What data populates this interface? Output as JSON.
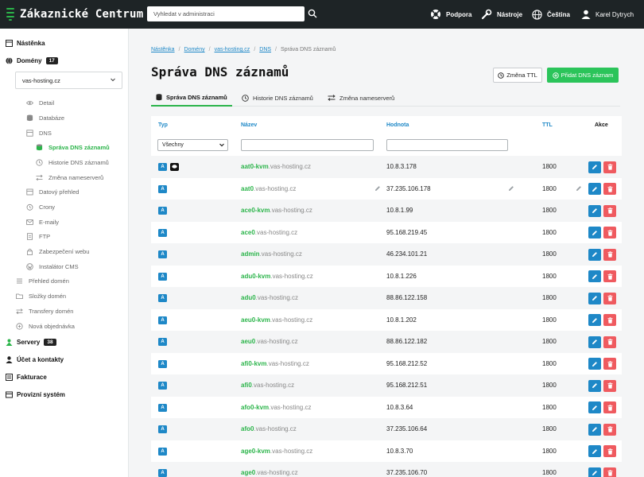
{
  "app": {
    "title": "Zákaznické Centrum"
  },
  "search": {
    "placeholder": "Vyhledat v administraci"
  },
  "top_nav": {
    "support": "Podpora",
    "tools": "Nástroje",
    "language": "Čeština",
    "user": "Karel Dytrych"
  },
  "sidebar": {
    "dashboard": "Nástěnka",
    "domains": "Domény",
    "domains_count": "17",
    "selected_domain": "vas-hosting.cz",
    "domain_items": [
      {
        "label": "Detail",
        "icon": "eye-icon"
      },
      {
        "label": "Databáze",
        "icon": "database-icon"
      },
      {
        "label": "DNS",
        "icon": "dns-icon"
      },
      {
        "label": "Správa DNS záznamů",
        "icon": "database-icon",
        "active": true
      },
      {
        "label": "Historie DNS záznamů",
        "icon": "history-icon"
      },
      {
        "label": "Změna nameserverů",
        "icon": "nameserver-icon"
      },
      {
        "label": "Datový přehled",
        "icon": "chart-icon"
      },
      {
        "label": "Crony",
        "icon": "clock-icon"
      },
      {
        "label": "E-maily",
        "icon": "mail-icon"
      },
      {
        "label": "FTP",
        "icon": "file-icon"
      },
      {
        "label": "Zabezpečení webu",
        "icon": "lock-icon"
      },
      {
        "label": "Instalátor CMS",
        "icon": "wordpress-icon"
      },
      {
        "label": "Přehled domén",
        "icon": "list-icon"
      },
      {
        "label": "Složky domén",
        "icon": "folder-icon"
      },
      {
        "label": "Transfery domén",
        "icon": "transfer-icon"
      },
      {
        "label": "Nová objednávka",
        "icon": "plus-circle-icon"
      }
    ],
    "servers": "Servery",
    "servers_count": "38",
    "account": "Účet a kontakty",
    "billing": "Fakturace",
    "system": "Provizní systém"
  },
  "breadcrumb": {
    "items": [
      "Nástěnka",
      "Domény",
      "vas-hosting.cz",
      "DNS"
    ],
    "current": "Správa DNS záznamů"
  },
  "page": {
    "title": "Správa DNS záznamů",
    "ttl_button": "Změna TTL",
    "add_button": "Přidat DNS záznam"
  },
  "tabs": [
    "Správa DNS záznamů",
    "Historie DNS záznamů",
    "Změna nameserverů"
  ],
  "table": {
    "headers": {
      "type": "Typ",
      "name": "Název",
      "value": "Hodnota",
      "ttl": "TTL",
      "actions": "Akce"
    },
    "type_filter": "Všechny",
    "domain_suffix": ".vas-hosting.cz",
    "rows": [
      {
        "type": "A",
        "host": "aat0-kvm",
        "value": "10.8.3.178",
        "ttl": "1800",
        "comment": true
      },
      {
        "type": "A",
        "host": "aat0",
        "value": "37.235.106.178",
        "ttl": "1800",
        "editing": true
      },
      {
        "type": "A",
        "host": "ace0-kvm",
        "value": "10.8.1.99",
        "ttl": "1800"
      },
      {
        "type": "A",
        "host": "ace0",
        "value": "95.168.219.45",
        "ttl": "1800"
      },
      {
        "type": "A",
        "host": "admin",
        "value": "46.234.101.21",
        "ttl": "1800"
      },
      {
        "type": "A",
        "host": "adu0-kvm",
        "value": "10.8.1.226",
        "ttl": "1800"
      },
      {
        "type": "A",
        "host": "adu0",
        "value": "88.86.122.158",
        "ttl": "1800"
      },
      {
        "type": "A",
        "host": "aeu0-kvm",
        "value": "10.8.1.202",
        "ttl": "1800"
      },
      {
        "type": "A",
        "host": "aeu0",
        "value": "88.86.122.182",
        "ttl": "1800"
      },
      {
        "type": "A",
        "host": "afi0-kvm",
        "value": "95.168.212.52",
        "ttl": "1800"
      },
      {
        "type": "A",
        "host": "afi0",
        "value": "95.168.212.51",
        "ttl": "1800"
      },
      {
        "type": "A",
        "host": "afo0-kvm",
        "value": "10.8.3.64",
        "ttl": "1800"
      },
      {
        "type": "A",
        "host": "afo0",
        "value": "37.235.106.64",
        "ttl": "1800"
      },
      {
        "type": "A",
        "host": "age0-kvm",
        "value": "10.8.3.70",
        "ttl": "1800"
      },
      {
        "type": "A",
        "host": "age0",
        "value": "37.235.106.70",
        "ttl": "1800"
      }
    ]
  },
  "colors": {
    "brand_green": "#2bb44a",
    "link_blue": "#1e88c7",
    "delete_red": "#ef5a5f",
    "topbar": "#1e2426"
  }
}
